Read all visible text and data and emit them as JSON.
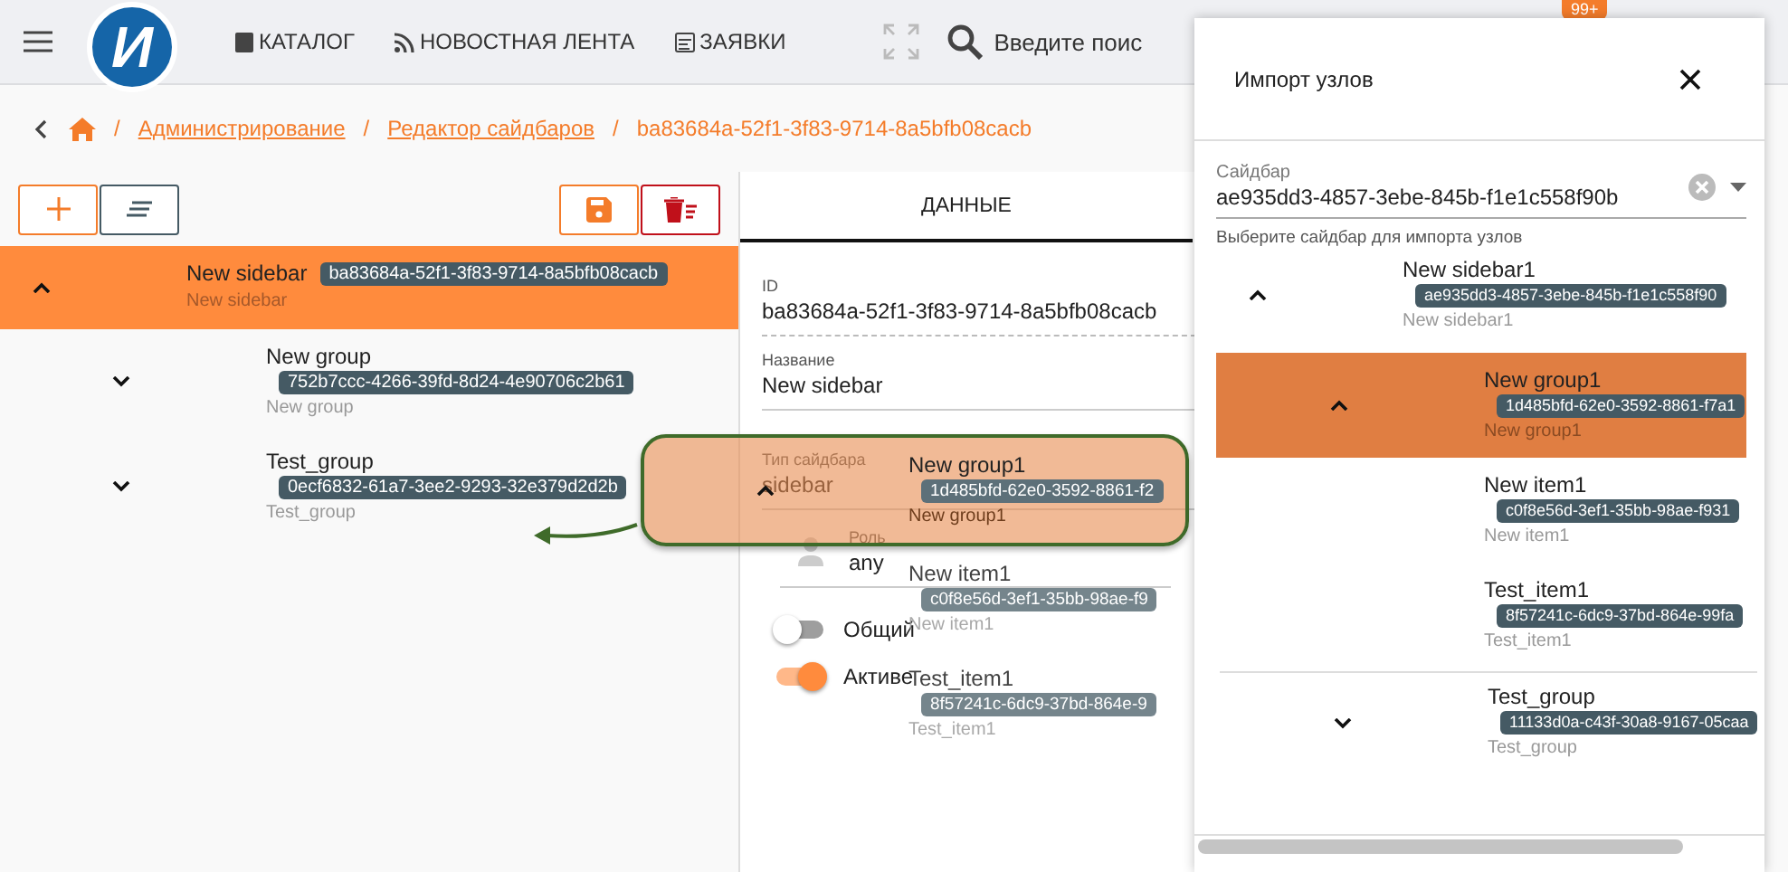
{
  "header": {
    "logo": "И",
    "nav": [
      {
        "label": "КАТАЛОГ",
        "kind": "book"
      },
      {
        "label": "НОВОСТНАЯ ЛЕНТА",
        "kind": "rss"
      },
      {
        "label": "ЗАЯВКИ",
        "kind": "form"
      }
    ],
    "search": {
      "placeholder": "Введите поис"
    },
    "badge": "99+"
  },
  "breadcrumbs": [
    {
      "sep": "/",
      "label": "Администрирование",
      "kind": "link"
    },
    {
      "sep": "/",
      "label": "Редактор сайдбаров",
      "kind": "link"
    },
    {
      "sep": "/",
      "label": "ba83684a-52f1-3f83-9714-8a5bfb08cacb",
      "kind": "current"
    }
  ],
  "tree": [
    {
      "title": "New sidebar",
      "id": "ba83684a-52f1-3f83-9714-8a5bfb08cacb",
      "subtitle": "New sidebar",
      "expanded": true,
      "selected": true,
      "children": [
        {
          "title": "New group",
          "id": "752b7ccc-4266-39fd-8d24-4e90706c2b61",
          "subtitle": "New group",
          "expanded": false,
          "selected": false
        },
        {
          "title": "Test_group",
          "id": "0ecf6832-61a7-3ee2-9293-32e379d2d2b",
          "subtitle": "Test_group",
          "expanded": false,
          "selected": false
        }
      ]
    }
  ],
  "form": {
    "tab": "ДАННЫЕ",
    "fields": [
      {
        "label": "ID",
        "value": "ba83684a-52f1-3f83-9714-8a5bfb08cacb",
        "kind": "readonly"
      },
      {
        "label": "Название",
        "value": "New sidebar",
        "kind": "text"
      },
      {
        "label": "Тип сайдбара",
        "value": "sidebar",
        "kind": "text"
      },
      {
        "label": "Роль",
        "value": "any",
        "kind": "person"
      }
    ],
    "toggles": [
      {
        "label": "Общий",
        "on": false
      },
      {
        "label": "Активе",
        "on": true
      }
    ]
  },
  "drag_ghost": {
    "node": {
      "title": "New group1",
      "id": "1d485bfd-62e0-3592-8861-f2",
      "subtitle": "New group1",
      "expanded": true
    },
    "children": [
      {
        "title": "New item1",
        "id": "c0f8e56d-3ef1-35bb-98ae-f9",
        "subtitle": "New item1"
      },
      {
        "title": "Test_item1",
        "id": "8f57241c-6dc9-37bd-864e-9",
        "subtitle": "Test_item1"
      }
    ]
  },
  "dialog": {
    "title": "Импорт узлов",
    "select": {
      "label": "Сайдбар",
      "value": "ae935dd3-4857-3ebe-845b-f1e1c558f90b"
    },
    "hint": "Выберите сайдбар для импорта узлов",
    "tree": [
      {
        "title": "New sidebar1",
        "id": "ae935dd3-4857-3ebe-845b-f1e1c558f90",
        "subtitle": "New sidebar1",
        "expanded": true,
        "selected": false,
        "children": [
          {
            "title": "New group1",
            "id": "1d485bfd-62e0-3592-8861-f7a1",
            "subtitle": "New group1",
            "expanded": true,
            "selected": true,
            "children": [
              {
                "title": "New item1",
                "id": "c0f8e56d-3ef1-35bb-98ae-f931",
                "subtitle": "New item1",
                "selected": false
              },
              {
                "title": "Test_item1",
                "id": "8f57241c-6dc9-37bd-864e-99fa",
                "subtitle": "Test_item1",
                "selected": false
              }
            ]
          },
          {
            "title": "Test_group",
            "id": "11133d0a-c43f-30a8-9167-05caa",
            "subtitle": "Test_group",
            "expanded": false,
            "selected": false
          }
        ]
      }
    ]
  }
}
